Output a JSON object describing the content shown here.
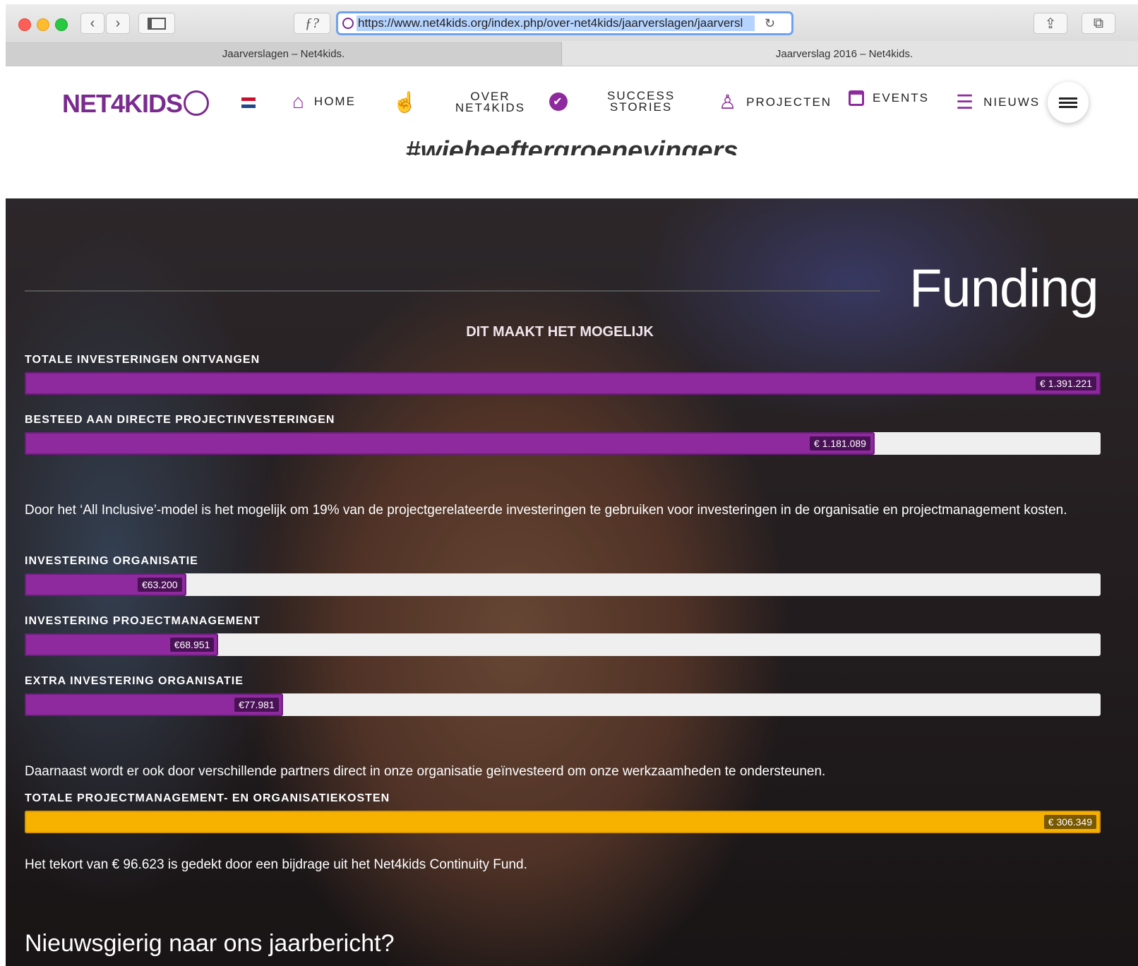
{
  "browser": {
    "url": "https://www.net4kids.org/index.php/over-net4kids/jaarverslagen/jaarversl",
    "tabs": [
      "Jaarverslagen – Net4kids.",
      "Jaarverslag 2016 – Net4kids."
    ],
    "reader_button": "ƒ?"
  },
  "site": {
    "logo_text": "NET4KIDS",
    "nav": [
      {
        "label": "HOME",
        "icon": "home-icon"
      },
      {
        "label_line1": "OVER",
        "label_line2": "NET4KIDS",
        "icon": "pointer-hand-icon"
      },
      {
        "label_line1": "SUCCESS",
        "label_line2": "STORIES",
        "icon": "check-circle-icon"
      },
      {
        "label": "PROJECTEN",
        "icon": "person-icon"
      },
      {
        "label": "EVENTS",
        "icon": "calendar-icon"
      },
      {
        "label": "NIEUWS",
        "icon": "newspaper-icon"
      }
    ],
    "hashtag": "#wieheeftergroenevingers"
  },
  "funding": {
    "title": "Funding",
    "subtitle": "DIT MAAKT HET MOGELIJK",
    "bars": [
      {
        "label": "TOTALE INVESTERINGEN ONTVANGEN",
        "value": "€ 1.391.221",
        "fraction": 1.0,
        "color": "#8e2a9e"
      },
      {
        "label": "BESTEED AAN DIRECTE PROJECTINVESTERINGEN",
        "value": "€ 1.181.089",
        "fraction": 0.79,
        "color": "#8e2a9e"
      },
      {
        "label": "INVESTERING ORGANISATIE",
        "value": "€63.200",
        "fraction": 0.15,
        "color": "#8e2a9e"
      },
      {
        "label": "INVESTERING PROJECTMANAGEMENT",
        "value": "€68.951",
        "fraction": 0.18,
        "color": "#8e2a9e"
      },
      {
        "label": "EXTRA INVESTERING ORGANISATIE",
        "value": "€77.981",
        "fraction": 0.24,
        "color": "#8e2a9e"
      },
      {
        "label": "TOTALE PROJECTMANAGEMENT- EN ORGANISATIEKOSTEN",
        "value": "€ 306.349",
        "fraction": 1.0,
        "color": "#f7b200"
      }
    ],
    "para1": "Door het ‘All Inclusive’-model is het mogelijk om 19% van de projectgerelateerde investeringen te gebruiken voor investeringen in de organisatie en projectmanagement kosten.",
    "para2": "Daarnaast wordt er ook door verschillende partners direct in onze organisatie geïnvesteerd om onze werkzaamheden te ondersteunen.",
    "para3": "Het tekort van € 96.623 is gedekt door een bijdrage uit het Net4kids Continuity Fund.",
    "bottom_heading": "Nieuwsgierig naar ons jaarbericht?"
  }
}
